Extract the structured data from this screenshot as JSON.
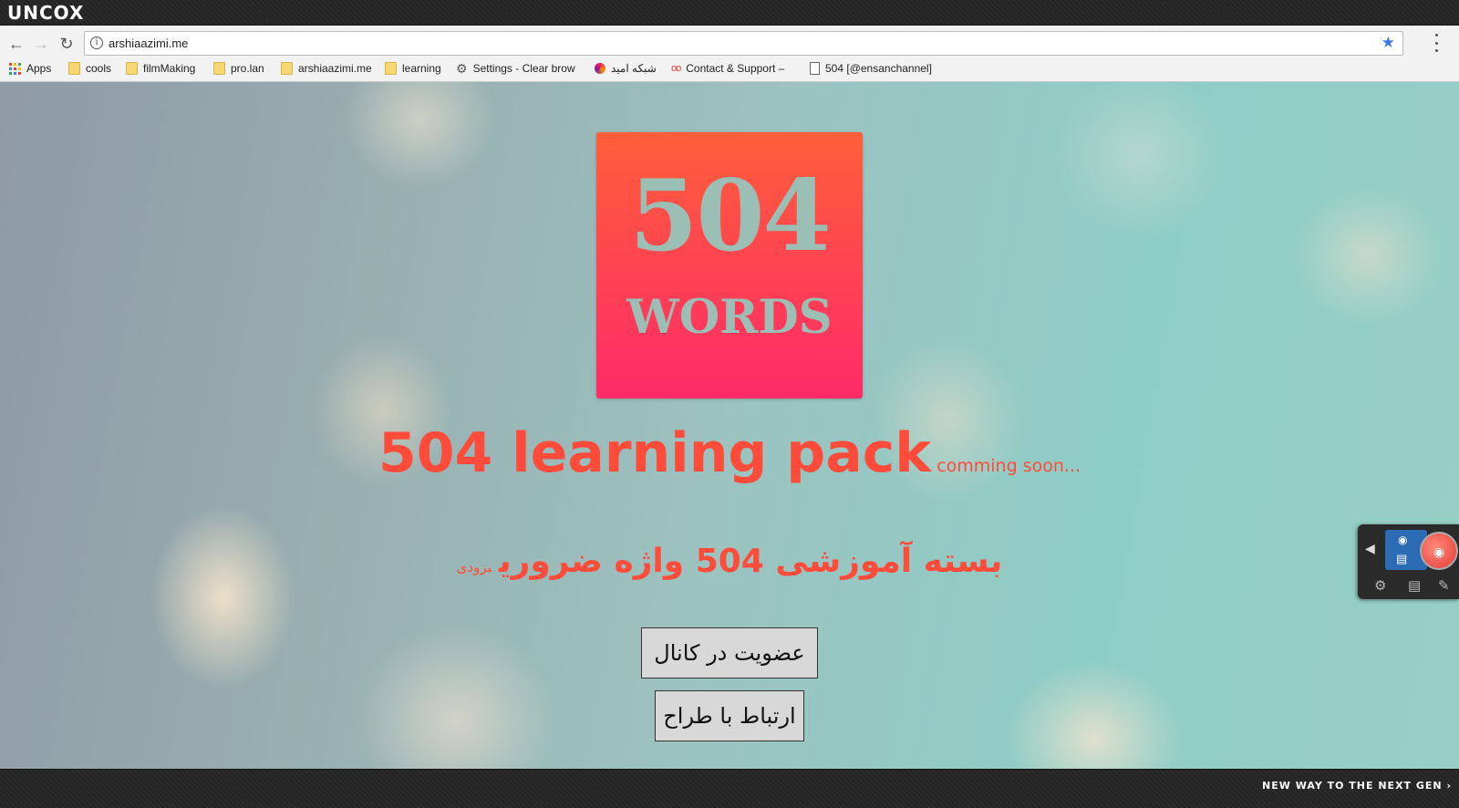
{
  "os": {
    "logo": "UNCOX",
    "tagline": "NEW WAY TO THE NEXT GEN ›"
  },
  "browser": {
    "url": "arshiaazimi.me",
    "icons": {
      "back": "arrow-left-icon",
      "forward": "arrow-right-icon",
      "reload": "reload-icon",
      "info": "info-icon",
      "star": "star-icon",
      "menu": "menu-dots-icon"
    },
    "bookmarks": [
      {
        "label": "Apps",
        "icon": "apps-grid-icon"
      },
      {
        "label": "cools",
        "icon": "folder-icon"
      },
      {
        "label": "filmMaking",
        "icon": "folder-icon"
      },
      {
        "label": "pro.lan",
        "icon": "folder-icon"
      },
      {
        "label": "arshiaazimi.me",
        "icon": "folder-icon"
      },
      {
        "label": "learning",
        "icon": "folder-icon"
      },
      {
        "label": "Settings - Clear brow",
        "icon": "gear-icon"
      },
      {
        "label": "شبکه امید",
        "icon": "swirl-icon"
      },
      {
        "label": "Contact & Support –",
        "icon": "oo-icon"
      },
      {
        "label": "504 [@ensanchannel]",
        "icon": "page-icon"
      }
    ]
  },
  "page": {
    "logo": {
      "number": "504",
      "word": "WORDS",
      "gradient_top": "#ff5e3a",
      "gradient_bottom": "#ff2a68",
      "text_color": "#9bbfb4"
    },
    "headline": "504 learning pack",
    "headline_suffix": "comming soon...",
    "persian_headline": "بسته آموزشی 504 واژه ضروری",
    "persian_suffix": "بزودی",
    "accent_color": "#ff4b3a",
    "buttons": {
      "join": "عضویت در کانال",
      "contact": "ارتباط با طراح"
    }
  },
  "capture_widget": {
    "icons": [
      "arrow-left-icon",
      "camera-icon",
      "video-icon",
      "record-icon",
      "gear-icon",
      "film-icon",
      "edit-icon"
    ]
  }
}
